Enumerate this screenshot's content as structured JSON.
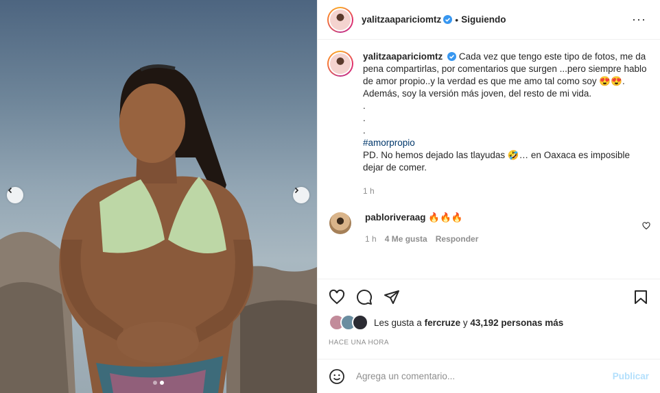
{
  "post": {
    "username": "yalitzaapariciomtz",
    "follow_status": "Siguiendo",
    "separator": "•",
    "more_icon": "···",
    "caption_lines": [
      "Cada vez que tengo este tipo de fotos, me da pena compartirlas, por comentarios que surgen ...pero siempre hablo de amor propio..y la verdad es que me amo tal como soy 😍😍.",
      "Además, soy la versión más joven, del resto de mi vida.",
      ".",
      ".",
      "."
    ],
    "hashtag": "#amorpropio",
    "caption_ps": "PD. No hemos dejado las tlayudas 🤣… en Oaxaca es imposible dejar de comer.",
    "caption_time": "1 h"
  },
  "comment": {
    "username": "pabloriveraag",
    "text": "🔥🔥🔥",
    "time": "1 h",
    "likes": "4 Me gusta",
    "reply": "Responder"
  },
  "likes": {
    "prefix": "Les gusta a",
    "user": "fercruze",
    "middle": "y",
    "count": "43,192 personas más"
  },
  "timestamp": "HACE UNA HORA",
  "composer": {
    "placeholder": "Agrega un comentario...",
    "publish": "Publicar"
  },
  "carousel": {
    "total": 2,
    "current": 2
  },
  "colors": {
    "verified": "#3897f0",
    "link": "#00376b",
    "publish_disabled": "#b2dffc"
  },
  "icons": [
    "chevron-left-icon",
    "chevron-right-icon",
    "verified-badge-icon",
    "more-options-icon",
    "heart-icon",
    "comment-icon",
    "share-icon",
    "bookmark-icon",
    "emoji-icon"
  ]
}
